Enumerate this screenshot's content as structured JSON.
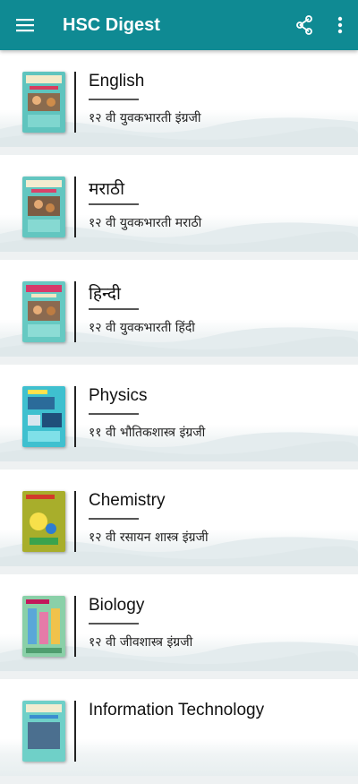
{
  "app": {
    "title": "HSC Digest",
    "primary_color": "#0f8a93",
    "icons": {
      "menu": "hamburger-menu-icon",
      "share": "share-icon",
      "more": "more-vert-icon"
    }
  },
  "books": [
    {
      "name": "English",
      "subtitle": "१२ वी युवकभारती इंग्रजी",
      "cover": "english-cover"
    },
    {
      "name": "मराठी",
      "subtitle": "१२ वी युवकभारती मराठी",
      "cover": "marathi-cover"
    },
    {
      "name": "हिन्दी",
      "subtitle": "१२ वी युवकभारती हिंदी",
      "cover": "hindi-cover"
    },
    {
      "name": "Physics",
      "subtitle": "११ वी भौतिकशास्त्र इंग्रजी",
      "cover": "physics-cover"
    },
    {
      "name": "Chemistry",
      "subtitle": "१२ वी रसायन शास्त्र इंग्रजी",
      "cover": "chemistry-cover"
    },
    {
      "name": "Biology",
      "subtitle": "१२ वी जीवशास्त्र इंग्रजी",
      "cover": "biology-cover"
    },
    {
      "name": "Information Technology",
      "subtitle": "",
      "cover": "it-cover"
    }
  ]
}
